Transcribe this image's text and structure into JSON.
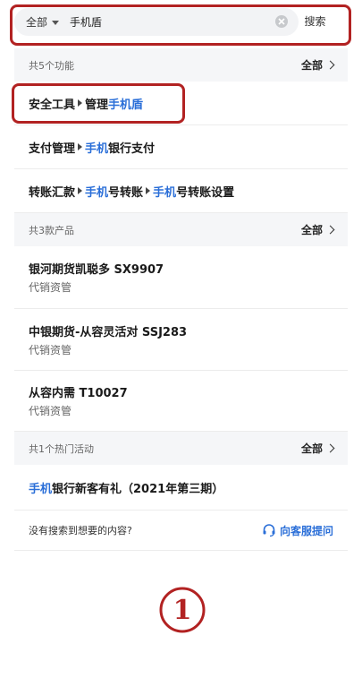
{
  "search": {
    "scope_label": "全部",
    "query": "手机盾",
    "button_label": "搜索"
  },
  "functions": {
    "count_label": "共5个功能",
    "all_label": "全部",
    "items": [
      {
        "segments": [
          {
            "text": "安全工具"
          },
          {
            "text": "管理"
          },
          {
            "text": "手机盾",
            "hl": true
          }
        ]
      },
      {
        "segments": [
          {
            "text": "支付管理"
          },
          {
            "text": "手机",
            "hl": true
          },
          {
            "text": "银行支付"
          }
        ]
      },
      {
        "segments": [
          {
            "text": "转账汇款"
          },
          {
            "text": "手机",
            "hl": true
          },
          {
            "text": "号转账"
          },
          {
            "text": "手机",
            "hl": true
          },
          {
            "text": "号转账设置"
          }
        ]
      }
    ]
  },
  "products": {
    "count_label": "共3款产品",
    "all_label": "全部",
    "items": [
      {
        "title": "银河期货凯聪多 SX9907",
        "sub": "代销资管"
      },
      {
        "title": "中银期货-从容灵活对 SSJ283",
        "sub": "代销资管"
      },
      {
        "title": "从容内需 T10027",
        "sub": "代销资管"
      }
    ]
  },
  "activities": {
    "count_label": "共1个热门活动",
    "all_label": "全部",
    "item_hl": "手机",
    "item_rest": "银行新客有礼（2021年第三期）"
  },
  "footer": {
    "question": "没有搜索到想要的内容?",
    "cs_label": "向客服提问"
  },
  "annotation": {
    "step": "1",
    "color": "#b22222"
  },
  "colors": {
    "accent": "#2b6fd8"
  }
}
